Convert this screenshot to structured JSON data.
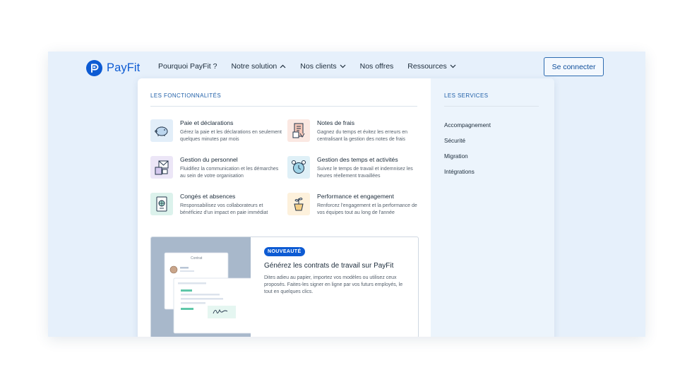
{
  "header": {
    "logo_text": "PayFit",
    "nav": [
      {
        "label": "Pourquoi PayFit ?",
        "icon": null
      },
      {
        "label": "Notre solution",
        "icon": "chevron-up-icon"
      },
      {
        "label": "Nos clients",
        "icon": "chevron-down-icon"
      },
      {
        "label": "Nos offres",
        "icon": null
      },
      {
        "label": "Ressources",
        "icon": "chevron-down-icon"
      }
    ],
    "connect_label": "Se connecter"
  },
  "dropdown": {
    "features_title": "LES FONCTIONNALITÉS",
    "features": [
      {
        "title": "Paie et déclarations",
        "desc": "Gérez la paie et les déclarations en seulement quelques minutes par mois",
        "icon": "piggy-bank-icon"
      },
      {
        "title": "Notes de frais",
        "desc": "Gagnez du temps et évitez les erreurs en centralisant la gestion des notes de frais",
        "icon": "receipt-icon"
      },
      {
        "title": "Gestion du personnel",
        "desc": "Fluidifiez la communication et les démarches au sein de votre organisation",
        "icon": "mail-document-icon"
      },
      {
        "title": "Gestion des temps et activités",
        "desc": "Suivez le temps de travail et indemnisez les heures réellement travaillées",
        "icon": "alarm-clock-icon"
      },
      {
        "title": "Congés et absences",
        "desc": "Responsabilisez vos collaborateurs et bénéficiez d'un impact en paie immédiat",
        "icon": "passport-icon"
      },
      {
        "title": "Performance et engagement",
        "desc": "Renforcez l'engagement et la performance de vos équipes tout au long de l'année",
        "icon": "plant-pot-icon"
      }
    ],
    "services_title": "LES SERVICES",
    "services": [
      "Accompagnement",
      "Sécurité",
      "Migration",
      "Intégrations"
    ],
    "promo": {
      "badge": "NOUVEAUTÉ",
      "title": "Générez les contrats de travail sur PayFit",
      "desc": "Dites adieu au papier, importez vos modèles ou utilisez ceux proposés. Faites-les signer en ligne par vos futurs employés, le tout en quelques clics.",
      "illustration_label": "Contrat"
    }
  },
  "colors": {
    "brand": "#0d5bd3",
    "frame_bg": "#e6f0fb",
    "services_bg": "#ecf4fc",
    "promo_image_bg": "#a8b8cb"
  }
}
